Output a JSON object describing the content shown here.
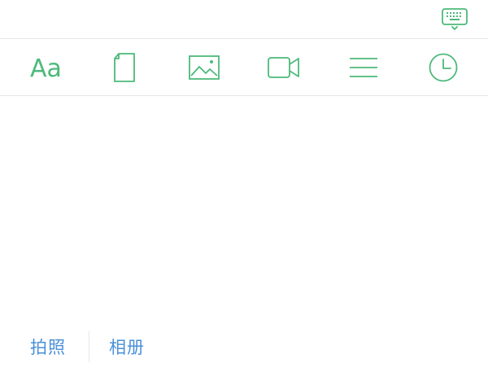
{
  "colors": {
    "accent": "#4cba7a",
    "link": "#4a90d9",
    "divider": "#e6e6e6"
  },
  "topbar": {
    "keyboard_icon": "keyboard-dismiss-icon"
  },
  "toolbar": {
    "tools": [
      {
        "name": "text-format",
        "icon": "text-format-icon",
        "glyph": "Aa"
      },
      {
        "name": "document",
        "icon": "document-icon"
      },
      {
        "name": "image",
        "icon": "image-icon"
      },
      {
        "name": "video",
        "icon": "video-icon"
      },
      {
        "name": "list",
        "icon": "list-icon"
      },
      {
        "name": "clock",
        "icon": "clock-icon"
      }
    ]
  },
  "bottombar": {
    "camera_label": "拍照",
    "album_label": "相册"
  }
}
